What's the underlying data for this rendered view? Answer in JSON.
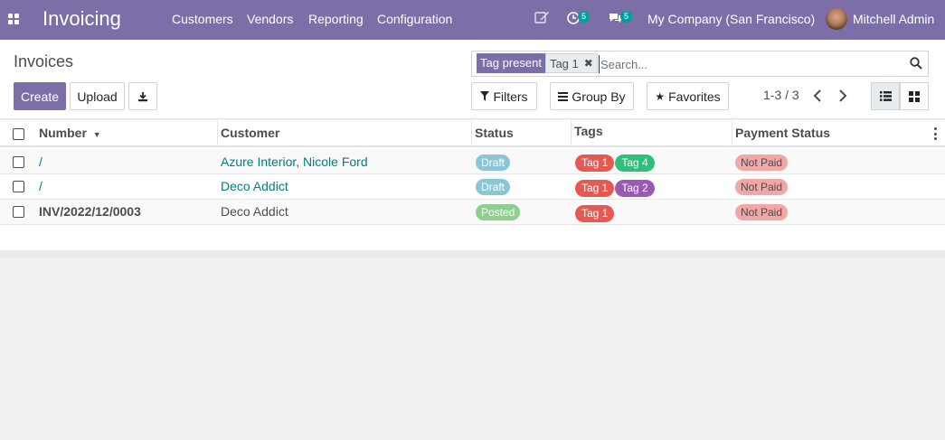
{
  "app": {
    "name": "Invoicing"
  },
  "menu": {
    "customers": "Customers",
    "vendors": "Vendors",
    "reporting": "Reporting",
    "configuration": "Configuration"
  },
  "systray": {
    "activity_count": "5",
    "messages_count": "5",
    "company": "My Company (San Francisco)",
    "user": "Mitchell Admin"
  },
  "breadcrumb": "Invoices",
  "search": {
    "facet_label": "Tag present",
    "facet_value": "Tag 1",
    "placeholder": "Search..."
  },
  "buttons": {
    "create": "Create",
    "upload": "Upload",
    "filters": "Filters",
    "group_by": "Group By",
    "favorites": "Favorites"
  },
  "pager": {
    "value": "1-3 / 3"
  },
  "table": {
    "columns": {
      "number": "Number",
      "customer": "Customer",
      "status": "Status",
      "tags": "Tags",
      "payment_status": "Payment Status"
    },
    "rows": [
      {
        "number": "/",
        "customer": "Azure Interior, Nicole Ford",
        "status": "Draft",
        "tags": [
          "Tag 1",
          "Tag 4"
        ],
        "payment_status": "Not Paid"
      },
      {
        "number": "/",
        "customer": "Deco Addict",
        "status": "Draft",
        "tags": [
          "Tag 1",
          "Tag 2"
        ],
        "payment_status": "Not Paid"
      },
      {
        "number": "INV/2022/12/0003",
        "customer": "Deco Addict",
        "status": "Posted",
        "tags": [
          "Tag 1"
        ],
        "payment_status": "Not Paid"
      }
    ]
  },
  "colors": {
    "brand": "#7c6fa8",
    "link": "#017e84",
    "draft": "#8bc6d6",
    "posted": "#8fce8f",
    "not_paid": "#f2a7a7",
    "tag_1": "#e45a52",
    "tag_4": "#2fbe7b",
    "tag_2": "#9b59b6"
  }
}
